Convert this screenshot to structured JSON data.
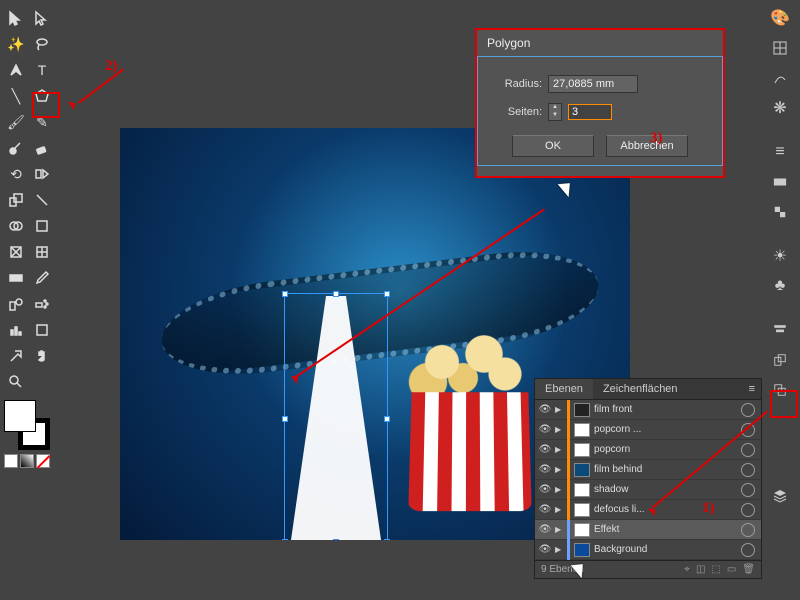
{
  "dialog": {
    "title": "Polygon",
    "radius_label": "Radius:",
    "radius_value": "27,0885 mm",
    "sides_label": "Seiten:",
    "sides_value": "3",
    "ok": "OK",
    "cancel": "Abbrechen"
  },
  "layers": {
    "tab1": "Ebenen",
    "tab2": "Zeichenflächen",
    "footer": "9 Ebenen",
    "items": [
      {
        "name": "film front",
        "color": "#ff8c00",
        "thumb": "#222"
      },
      {
        "name": "popcorn ...",
        "color": "#ff8c00",
        "thumb": "#fff"
      },
      {
        "name": "popcorn",
        "color": "#ff8c00",
        "thumb": "#fff"
      },
      {
        "name": "film behind",
        "color": "#ff8c00",
        "thumb": "#0a4a7a"
      },
      {
        "name": "shadow",
        "color": "#ff8c00",
        "thumb": "#fff"
      },
      {
        "name": "defocus li...",
        "color": "#ff8c00",
        "thumb": "#fff"
      },
      {
        "name": "Effekt",
        "color": "#6aa3ff",
        "thumb": "#fff",
        "selected": true
      },
      {
        "name": "Background",
        "color": "#6aa3ff",
        "thumb": "#0a4a9a"
      }
    ]
  },
  "annotations": {
    "a1": "1)",
    "a2": "2)",
    "a3": "3)"
  }
}
